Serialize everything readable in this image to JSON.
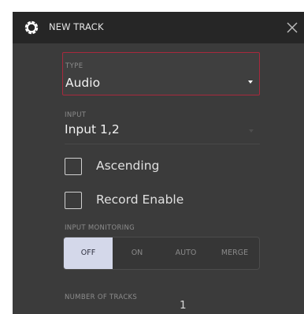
{
  "dialog": {
    "title": "NEW TRACK",
    "icons": {
      "settings": "gear-icon",
      "close": "close-icon"
    }
  },
  "type_field": {
    "label": "TYPE",
    "value": "Audio"
  },
  "input_field": {
    "label": "INPUT",
    "value": "Input 1,2"
  },
  "checkboxes": [
    {
      "label": "Ascending",
      "checked": false
    },
    {
      "label": "Record Enable",
      "checked": false
    }
  ],
  "input_monitoring": {
    "label": "INPUT MONITORING",
    "options": [
      "OFF",
      "ON",
      "AUTO",
      "MERGE"
    ],
    "selected": "OFF"
  },
  "number_of_tracks": {
    "label": "NUMBER OF TRACKS",
    "value": "1"
  },
  "colors": {
    "dialog_bg": "#3b3b3b",
    "titlebar_bg": "#262626",
    "type_border": "#a8293d",
    "selected_segment_bg": "#d4d8ea"
  }
}
